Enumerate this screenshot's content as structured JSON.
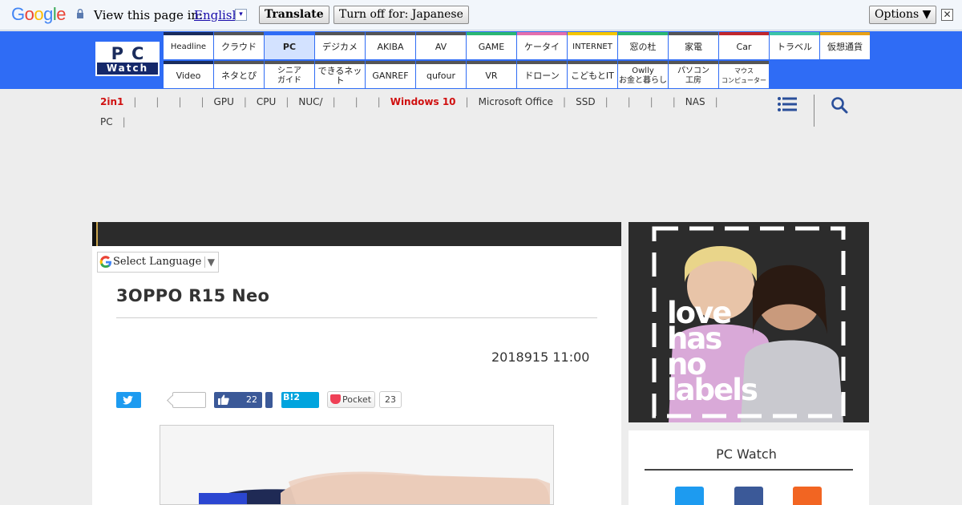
{
  "translate_bar": {
    "logo_letters": [
      "G",
      "o",
      "o",
      "g",
      "l",
      "e"
    ],
    "logo_colors": [
      "#4285f4",
      "#ea4335",
      "#fbbc05",
      "#4285f4",
      "#34a853",
      "#ea4335"
    ],
    "prompt": "View this page in:",
    "language": "English",
    "translate_label": "Translate",
    "turn_off_label": "Turn off for: Japanese",
    "options_label": "Options ▼",
    "close_glyph": "✕"
  },
  "header": {
    "logo_top": "PC",
    "logo_bottom": "Watch",
    "nav_row1": [
      {
        "label": "Headline",
        "color": "#1a2c5c"
      },
      {
        "label": "クラウド",
        "color": "#555555"
      },
      {
        "label": "PC",
        "color": "#2f6cf5",
        "active": true
      },
      {
        "label": "デジカメ",
        "color": "#555555"
      },
      {
        "label": "AKIBA",
        "color": "#555555"
      },
      {
        "label": "AV",
        "color": "#555555"
      },
      {
        "label": "GAME",
        "color": "#2bb673"
      },
      {
        "label": "ケータイ",
        "color": "#e36fae"
      },
      {
        "label": "INTERNET",
        "color": "#f5c600"
      },
      {
        "label": "窓の杜",
        "color": "#2bb673"
      },
      {
        "label": "家電",
        "color": "#555555"
      },
      {
        "label": "Car",
        "color": "#c0272d"
      },
      {
        "label": "トラベル",
        "color": "#3cc4a8"
      },
      {
        "label": "仮想通貨",
        "color": "#e8a117"
      }
    ],
    "nav_row2": [
      {
        "label": "Video",
        "color": "#1a2c5c"
      },
      {
        "label": "ネタとぴ",
        "color": "#555555"
      },
      {
        "label": "シニア\nガイド",
        "color": "#555555"
      },
      {
        "label": "できるネット",
        "color": "#555555"
      },
      {
        "label": "GANREF",
        "color": "#555555"
      },
      {
        "label": "qufour",
        "color": "#555555"
      },
      {
        "label": "VR",
        "color": "#555555"
      },
      {
        "label": "ドローン",
        "color": "#555555"
      },
      {
        "label": "こどもとIT",
        "color": "#555555"
      },
      {
        "label": "Owlly\nお金と暮らし",
        "color": "#555555"
      },
      {
        "label": "パソコン\n工房",
        "color": "#555555"
      },
      {
        "label": "マウス\nコンピューター",
        "color": "#555555"
      }
    ]
  },
  "tags": {
    "line1": [
      {
        "label": "2in1",
        "red": true
      },
      {
        "label": ""
      },
      {
        "label": ""
      },
      {
        "label": ""
      },
      {
        "label": "GPU"
      },
      {
        "label": "CPU"
      },
      {
        "label": "NUC/"
      },
      {
        "label": ""
      },
      {
        "label": ""
      },
      {
        "label": "Windows 10",
        "red": true
      },
      {
        "label": "Microsoft Office"
      },
      {
        "label": "SSD"
      },
      {
        "label": ""
      },
      {
        "label": ""
      },
      {
        "label": ""
      },
      {
        "label": "NAS"
      }
    ],
    "line2": [
      {
        "label": "PC"
      }
    ]
  },
  "article": {
    "select_language": "Select Language",
    "title": "3OPPO R15 Neo",
    "date": "2018915 11:00",
    "fb_count": "22",
    "hatena_label": "B!",
    "hatena_count": "2",
    "pocket_label": "Pocket",
    "pocket_count": "23"
  },
  "ad": {
    "text_lines": [
      "love",
      "has",
      "no",
      "labels"
    ]
  },
  "sidebar": {
    "title": "PC Watch"
  }
}
